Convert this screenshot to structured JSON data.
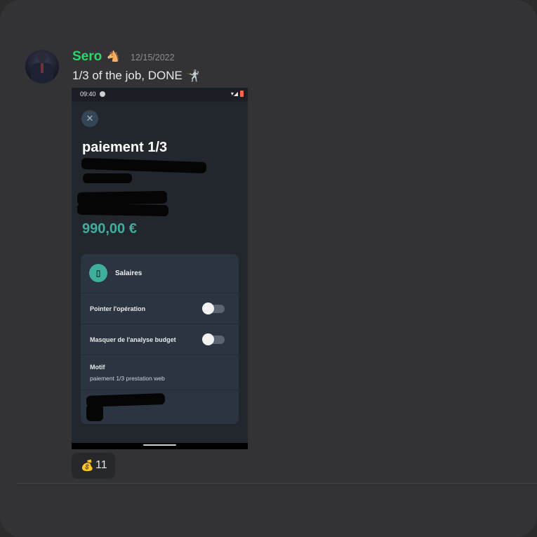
{
  "message": {
    "username": "Sero",
    "username_badge": "🐴",
    "timestamp": "12/15/2022",
    "text": "1/3 of the job, DONE",
    "text_emoji": "🤺",
    "username_color": "#2bd66a"
  },
  "attachment": {
    "status_time": "09:40",
    "close_glyph": "✕",
    "title": "paiement 1/3",
    "amount": "990,00 €",
    "amount_color": "#3fae9c",
    "category": {
      "icon": "receipt-icon",
      "label": "Salaires"
    },
    "rows": [
      {
        "label": "Pointer l'opération",
        "toggle_on": false
      },
      {
        "label": "Masquer de l'analyse budget",
        "toggle_on": false
      }
    ],
    "motif": {
      "label": "Motif",
      "value": "paiement 1/3 prestation web"
    }
  },
  "reaction": {
    "emoji": "💰",
    "count": "11"
  }
}
